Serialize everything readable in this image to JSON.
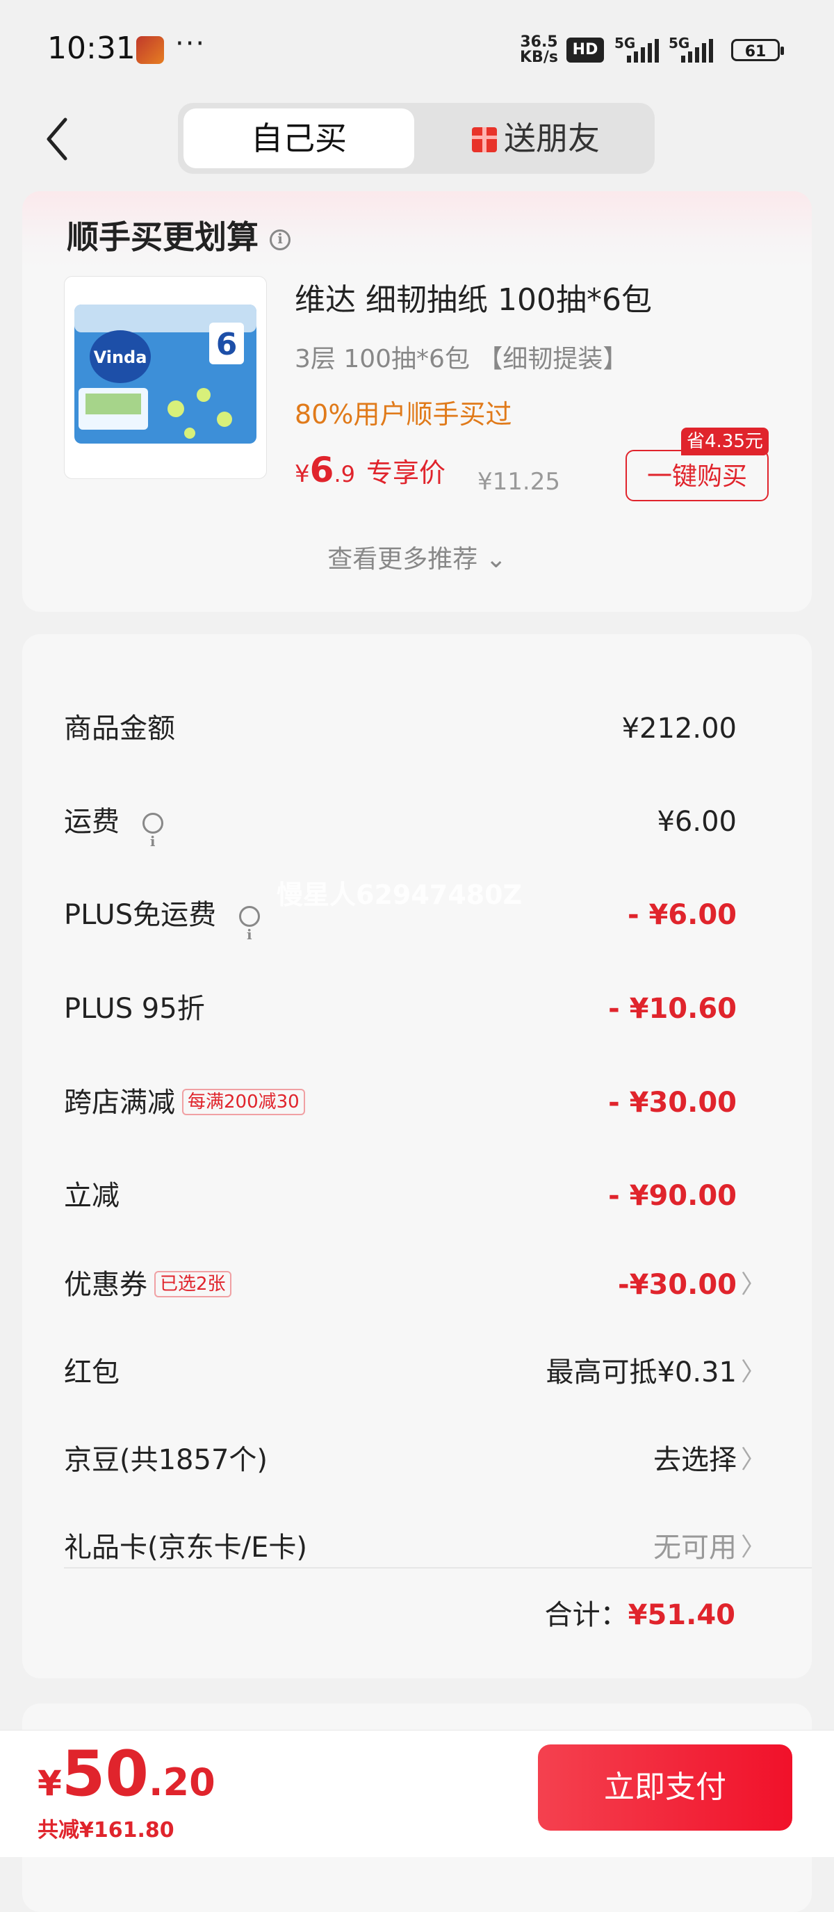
{
  "status_bar": {
    "time": "10:31",
    "more": "···",
    "net_speed_value": "36.5",
    "net_speed_unit": "KB/s",
    "hd_badge": "HD",
    "signal_label": "5G",
    "battery": "61"
  },
  "header": {
    "tabs": [
      {
        "label": "自己买",
        "active": true
      },
      {
        "label": "送朋友",
        "active": false
      }
    ]
  },
  "recommend": {
    "title": "顺手买更划算",
    "product": {
      "name": "维达 细韧抽纸 100抽*6包",
      "spec": "3层 100抽*6包 【细韧提装】",
      "bought": "80%用户顺手买过",
      "price_currency": "¥",
      "price_int": "6",
      "price_dec": ".9",
      "price_tag": "专享价",
      "original_price": "¥11.25",
      "save_badge": "省4.35元",
      "buy_button": "一键购买",
      "image_brand": "Vinda",
      "image_count": "6"
    },
    "more_link": "查看更多推荐 ⌄"
  },
  "summary": {
    "rows": [
      {
        "label": "商品金额",
        "value": "¥212.00"
      },
      {
        "label": "运费",
        "value": "¥6.00"
      },
      {
        "label": "PLUS免运费",
        "value": "- ¥6.00"
      },
      {
        "label": "PLUS 95折",
        "value": "- ¥10.60"
      },
      {
        "label": "跨店满减",
        "chip": "每满200减30",
        "value": "- ¥30.00"
      },
      {
        "label": "立减",
        "value": "- ¥90.00"
      },
      {
        "label": "优惠券",
        "chip": "已选2张",
        "value": "-¥30.00"
      },
      {
        "label": "红包",
        "value": "最高可抵¥0.31"
      },
      {
        "label": "京豆(共1857个)",
        "value": "去选择"
      },
      {
        "label": "礼品卡(京东卡/E卡)",
        "value": "无可用"
      }
    ],
    "total_label": "合计：",
    "total_value": "¥51.40",
    "watermark": "慢星人62947480Z"
  },
  "bottom_bar": {
    "currency": "¥",
    "pay_int": "50",
    "pay_dec": ".20",
    "saved": "共减¥161.80",
    "pay_button": "立即支付"
  },
  "colors": {
    "accent_red": "#e0242c",
    "orange": "#e07a1a",
    "pay_button": "#f1112a"
  }
}
